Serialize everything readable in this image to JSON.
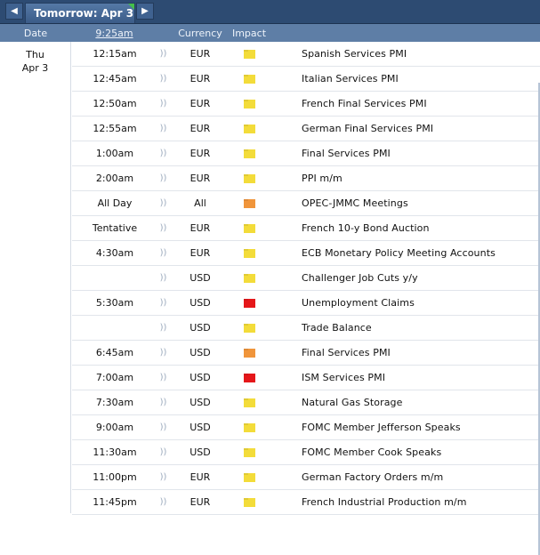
{
  "nav": {
    "prev_glyph": "◀",
    "next_glyph": "▶",
    "tab_label": "Tomorrow: Apr 3"
  },
  "header": {
    "date": "Date",
    "time": "9:25am",
    "currency": "Currency",
    "impact": "Impact"
  },
  "date_cell": {
    "day": "Thu",
    "date": "Apr 3"
  },
  "impact_colors": {
    "low": "#f3dc3a",
    "medium": "#f0953b",
    "high": "#e5171a"
  },
  "sound_glyph": "))",
  "events": [
    {
      "time": "12:15am",
      "currency": "EUR",
      "impact": "low",
      "event": "Spanish Services PMI"
    },
    {
      "time": "12:45am",
      "currency": "EUR",
      "impact": "low",
      "event": "Italian Services PMI"
    },
    {
      "time": "12:50am",
      "currency": "EUR",
      "impact": "low",
      "event": "French Final Services PMI"
    },
    {
      "time": "12:55am",
      "currency": "EUR",
      "impact": "low",
      "event": "German Final Services PMI"
    },
    {
      "time": "1:00am",
      "currency": "EUR",
      "impact": "low",
      "event": "Final Services PMI"
    },
    {
      "time": "2:00am",
      "currency": "EUR",
      "impact": "low",
      "event": "PPI m/m"
    },
    {
      "time": "All Day",
      "currency": "All",
      "impact": "medium",
      "event": "OPEC-JMMC Meetings"
    },
    {
      "time": "Tentative",
      "currency": "EUR",
      "impact": "low",
      "event": "French 10-y Bond Auction"
    },
    {
      "time": "4:30am",
      "currency": "EUR",
      "impact": "low",
      "event": "ECB Monetary Policy Meeting Accounts"
    },
    {
      "time": "",
      "currency": "USD",
      "impact": "low",
      "event": "Challenger Job Cuts y/y"
    },
    {
      "time": "5:30am",
      "currency": "USD",
      "impact": "high",
      "event": "Unemployment Claims"
    },
    {
      "time": "",
      "currency": "USD",
      "impact": "low",
      "event": "Trade Balance"
    },
    {
      "time": "6:45am",
      "currency": "USD",
      "impact": "medium",
      "event": "Final Services PMI"
    },
    {
      "time": "7:00am",
      "currency": "USD",
      "impact": "high",
      "event": "ISM Services PMI"
    },
    {
      "time": "7:30am",
      "currency": "USD",
      "impact": "low",
      "event": "Natural Gas Storage"
    },
    {
      "time": "9:00am",
      "currency": "USD",
      "impact": "low",
      "event": "FOMC Member Jefferson Speaks"
    },
    {
      "time": "11:30am",
      "currency": "USD",
      "impact": "low",
      "event": "FOMC Member Cook Speaks"
    },
    {
      "time": "11:00pm",
      "currency": "EUR",
      "impact": "low",
      "event": "German Factory Orders m/m"
    },
    {
      "time": "11:45pm",
      "currency": "EUR",
      "impact": "low",
      "event": "French Industrial Production m/m"
    }
  ]
}
